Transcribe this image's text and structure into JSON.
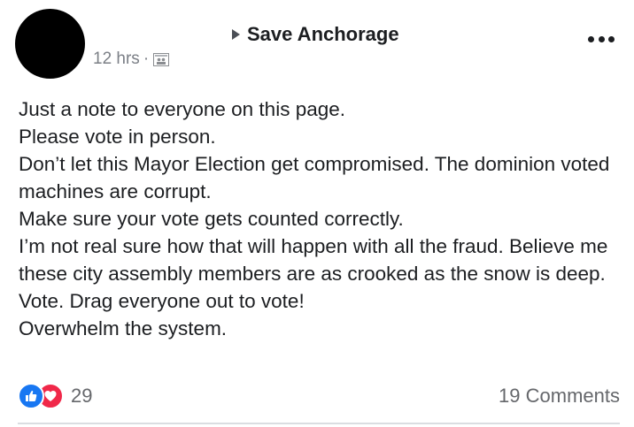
{
  "post": {
    "group_name": "Save Anchorage",
    "timestamp": "12 hrs",
    "separator": "·",
    "audience_icon": "group-audience-icon",
    "more_icon": "more-options-icon",
    "lines": [
      "Just a note to everyone on this page.",
      "Please vote in person.",
      "Don’t let this Mayor Election get compromised. The dominion voted machines are corrupt.",
      "Make sure your vote gets counted correctly.",
      "I’m not real sure how that will happen with all the fraud. Believe me these city assembly members are as crooked as the snow is deep.",
      "Vote. Drag everyone out to vote!",
      "Overwhelm the system."
    ]
  },
  "footer": {
    "reaction_count": "29",
    "comments_label": "19 Comments",
    "reaction_icons": [
      "like-icon",
      "love-icon"
    ]
  },
  "colors": {
    "like": "#1877f2",
    "love": "#f02849",
    "secondary_text": "#65676b"
  }
}
